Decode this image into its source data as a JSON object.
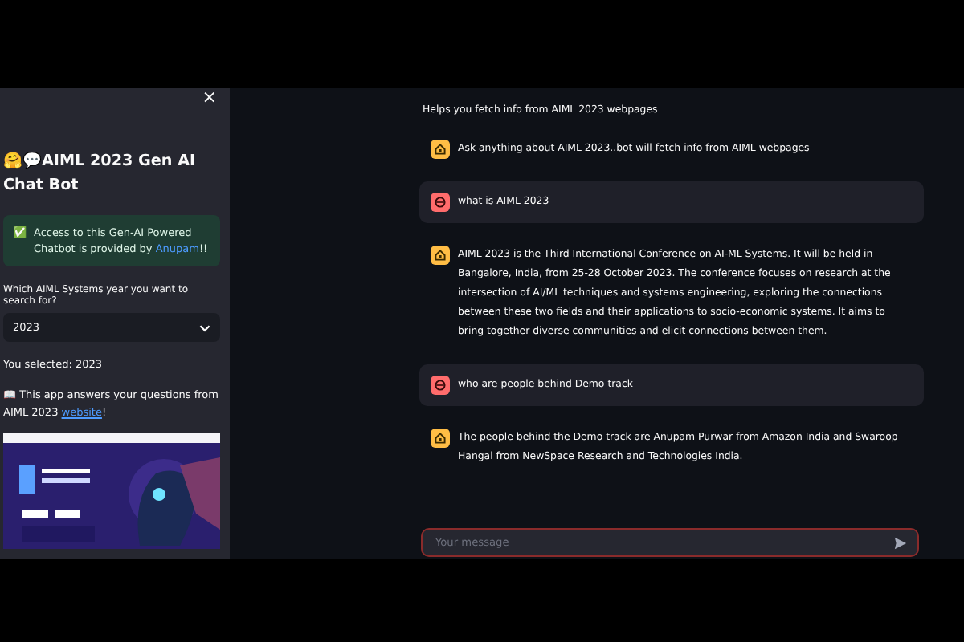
{
  "sidebar": {
    "close": "×",
    "title": "🤗💬AIML 2023 Gen AI Chat Bot",
    "alert": {
      "icon": "✅",
      "text": "Access to this Gen-AI Powered Chatbot is provided by ",
      "link": "Anupam",
      "after": "!!"
    },
    "select": {
      "label": "Which AIML Systems year you want to search for?",
      "value": "2023"
    },
    "selected_text": "You selected: 2023",
    "info": {
      "text": "📖 This app answers your questions from AIML 2023 ",
      "link": "website",
      "after": "!"
    }
  },
  "main": {
    "caption": "Helps you fetch info from AIML 2023 webpages",
    "messages": [
      {
        "kind": "assistant",
        "text": "Ask anything about AIML 2023..bot will fetch info from AIML webpages"
      },
      {
        "kind": "user",
        "text": "what is AIML 2023"
      },
      {
        "kind": "assistant",
        "text": "AIML 2023 is the Third International Conference on AI-ML Systems. It will be held in Bangalore, India, from 25-28 October 2023. The conference focuses on research at the intersection of AI/ML techniques and systems engineering, exploring the connections between these two fields and their applications to socio-economic systems. It aims to bring together diverse communities and elicit connections between them."
      },
      {
        "kind": "user",
        "text": "who are people behind Demo track"
      },
      {
        "kind": "assistant",
        "text": "The people behind the Demo track are Anupam Purwar from Amazon India and Swaroop Hangal from NewSpace Research and Technologies India."
      }
    ],
    "input": {
      "placeholder": "Your message"
    }
  }
}
